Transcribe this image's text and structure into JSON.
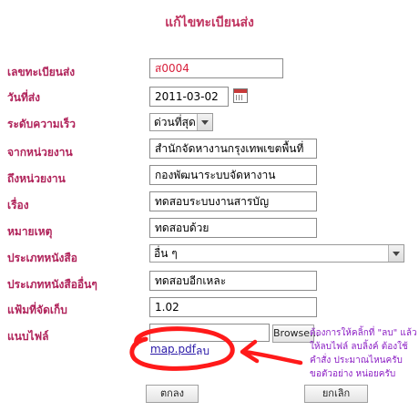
{
  "page": {
    "title": "แก้ไขทะเบียนส่ง"
  },
  "form": {
    "doc_no": {
      "label": "เลขทะเบียนส่ง",
      "value": "ส0004"
    },
    "send_date": {
      "label": "วันที่ส่ง",
      "value": "2011-03-02"
    },
    "urgency": {
      "label": "ระดับความเร็ว",
      "value": "ด่วนที่สุด"
    },
    "from_unit": {
      "label": "จากหน่วยงาน",
      "value": "สำนักจัดหางานกรุงเทพเขตพื้นที่"
    },
    "to_unit": {
      "label": "ถึงหน่วยงาน",
      "value": "กองพัฒนาระบบจัดหางาน"
    },
    "subject": {
      "label": "เรื่อง",
      "value": "ทดสอบระบบงานสารบัญ"
    },
    "remark": {
      "label": "หมายเหตุ",
      "value": "ทดสอบด้วย"
    },
    "doc_type": {
      "label": "ประเภทหนังสือ",
      "value": "อื่น ๆ"
    },
    "doc_type_other": {
      "label": "ประเภทหนังสืออื่นๆ",
      "value": "ทดสอบอีกเหละ"
    },
    "folder": {
      "label": "แฟ้มที่จัดเก็บ",
      "value": "1.02"
    },
    "attach": {
      "label": "แนบไฟล์",
      "browse_label": "Browse...",
      "file_name": "map.pdf",
      "delete_label": "ลบ"
    }
  },
  "annotation": {
    "note": "ต้องการให้คลิ้กที่ \"ลบ\" แล้ว ให้ลบไฟล์ ลบลิ้งค์ ต้องใช้คำสั่ง ประมาณไหนครับ ขอตัวอย่าง หน่อยครับ",
    "color": "#ff1a1a"
  },
  "buttons": {
    "save_label": "ตกลง",
    "cancel_label": "ยกเลิก"
  },
  "colors": {
    "label": "#b0235a",
    "title": "#c0335f",
    "note": "#8b1ec4"
  }
}
